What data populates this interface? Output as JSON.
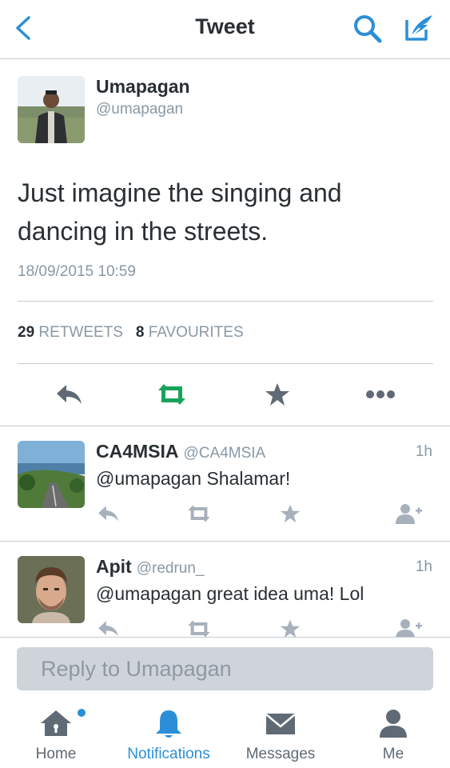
{
  "header": {
    "title": "Tweet",
    "icons": [
      "back-chevron-icon",
      "search-icon",
      "compose-icon"
    ],
    "accent_color": "#2b8fd8"
  },
  "tweet": {
    "author_name": "Umapagan",
    "author_handle": "@umapagan",
    "text_line1": "Just imagine the singing and",
    "text_line2": "dancing in the streets.",
    "timestamp": "18/09/2015 10:59",
    "retweet_count": "29",
    "retweet_label": "RETWEETS",
    "favourite_count": "8",
    "favourite_label": "FAVOURITES",
    "actions": [
      "reply-icon",
      "retweet-icon",
      "favourite-icon",
      "more-icon"
    ],
    "retweeted_color": "#19a35a"
  },
  "replies": [
    {
      "name": "CA4MSIA",
      "handle": "@CA4MSIA",
      "time": "1h",
      "text": "@umapagan Shalamar!",
      "actions": [
        "reply-icon",
        "retweet-icon",
        "favourite-icon",
        "follow-icon"
      ]
    },
    {
      "name": "Apit",
      "handle": "@redrun_",
      "time": "1h",
      "text": "@umapagan great idea uma! Lol",
      "actions": [
        "reply-icon",
        "retweet-icon",
        "favourite-icon",
        "follow-icon"
      ]
    }
  ],
  "reply_bar": {
    "placeholder": "Reply to Umapagan"
  },
  "tabbar": {
    "home": "Home",
    "notifications": "Notifications",
    "messages": "Messages",
    "me": "Me",
    "active": "Notifications"
  }
}
